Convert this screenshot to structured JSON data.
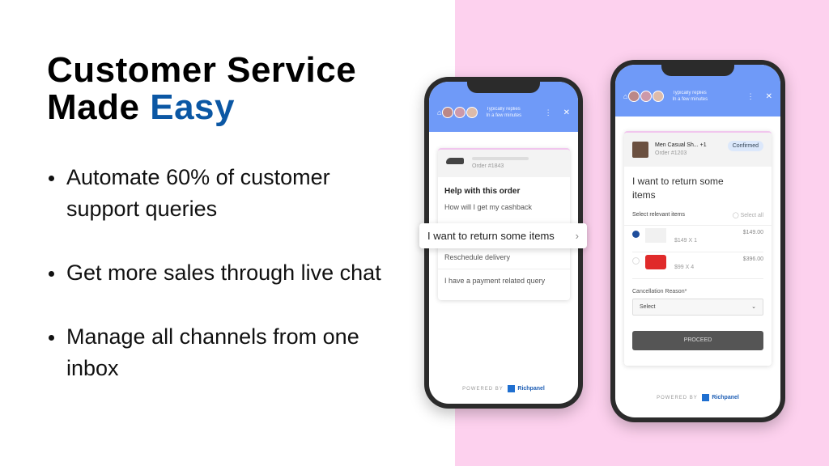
{
  "title": {
    "line1": "Customer Service",
    "line2_prefix": "Made",
    "line2_accent": "Easy",
    "accent_color": "#0b57a4"
  },
  "background_right": "#fdd1ee",
  "bullets": [
    "Automate 60% of customer support queries",
    "Get more sales through live chat",
    "Manage all channels from one inbox"
  ],
  "chat_header": {
    "replies": "Typically replies",
    "time": "In a few minutes",
    "color": "#6f9af8"
  },
  "phone1": {
    "order": "Order #1843",
    "help_title": "Help with this order",
    "options": [
      "How will I get my cashback",
      "I want to return some items",
      "Reschedule delivery",
      "I have a payment related query"
    ]
  },
  "phone2": {
    "product": "Men Casual Sh... +1",
    "order": "Order #1203",
    "status": "Confirmed",
    "heading": "I want to return some items",
    "select_label": "Select relevant items",
    "select_all": "Select all",
    "items": [
      {
        "qty": "$149 X 1",
        "total": "$149.00",
        "checked": true
      },
      {
        "qty": "$99 X 4",
        "total": "$396.00",
        "checked": false
      }
    ],
    "reason_label": "Cancellation Reason*",
    "reason_value": "Select",
    "proceed": "PROCEED"
  },
  "powered": {
    "by": "POWERED BY",
    "brand": "Richpanel"
  }
}
